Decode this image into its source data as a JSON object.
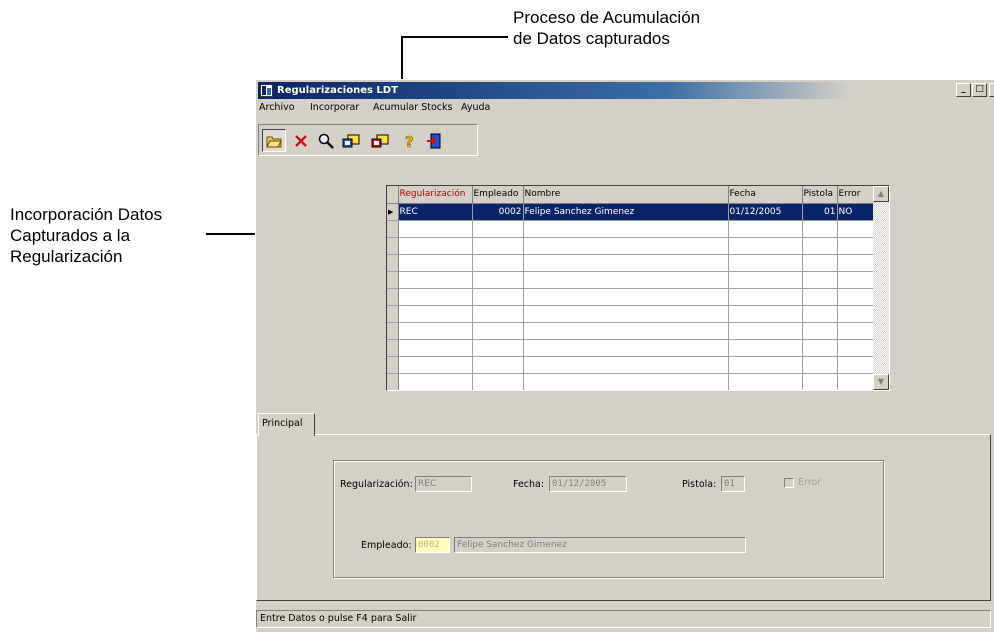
{
  "annotations": {
    "acumulacion": [
      "Proceso de Acumulación",
      "de Datos capturados"
    ],
    "incorporacion": [
      "Incorporación Datos",
      "Capturados a la",
      "Regularización"
    ]
  },
  "window": {
    "title": "Regularizaciones LDT",
    "controls": {
      "minimize": "_",
      "maximize": "□",
      "close": "×"
    }
  },
  "menu": [
    "Archivo",
    "Incorporar",
    "Acumular Stocks",
    "Ayuda"
  ],
  "toolbar": {
    "buttons": [
      "open-folder-icon",
      "delete-icon",
      "search-icon",
      "incorporate-icon",
      "accumulate-icon",
      "help-icon",
      "exit-icon"
    ]
  },
  "grid": {
    "columns": [
      "Regularización",
      "Empleado",
      "Nombre",
      "Fecha",
      "Pistola",
      "Error"
    ],
    "rows": [
      [
        "REC",
        "0002",
        "Felipe Sanchez Gimenez",
        "01/12/2005",
        "01",
        "NO"
      ]
    ],
    "scroll_up": "▲",
    "scroll_down": "▼"
  },
  "tabs": {
    "principal": "Principal"
  },
  "form": {
    "regularizacion_label": "Regularización:",
    "regularizacion_value": "REC",
    "fecha_label": "Fecha:",
    "fecha_value": "01/12/2005",
    "pistola_label": "Pistola:",
    "pistola_value": "01",
    "error_label": "Error",
    "empleado_label": "Empleado:",
    "empleado_code": "0002",
    "empleado_name": "Felipe Sanchez Gimenez"
  },
  "status": {
    "text": "Entre Datos o pulse F4 para Salir"
  },
  "colors": {
    "title_bar": "#0a246a",
    "selection": "#0a246a",
    "header_red": "#c00000",
    "window_bg": "#d4d0c8"
  }
}
